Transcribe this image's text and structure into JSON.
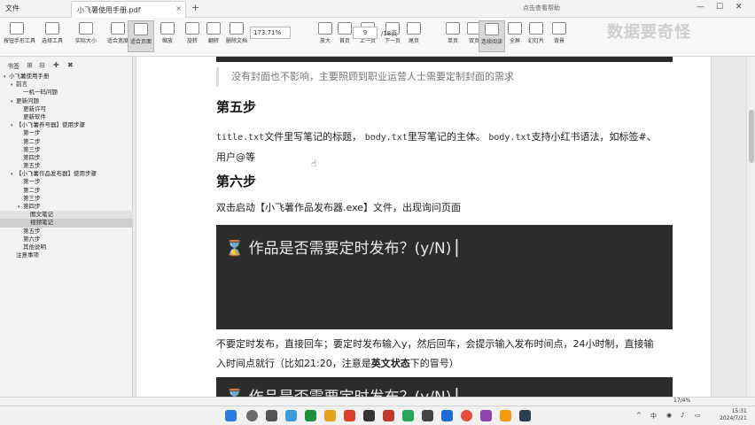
{
  "titlebar": {
    "file_menu": "文件",
    "tab_title": "小飞薯使用手册.pdf",
    "search_placeholder": "点击查看帮助"
  },
  "toolbar": {
    "items": [
      {
        "label": "按钮手形工具",
        "icon": "hand-icon"
      },
      {
        "label": "选择工具",
        "icon": "select-icon"
      },
      {
        "label": "实际大小",
        "icon": "actual-size-icon"
      },
      {
        "label": "适合宽度",
        "icon": "fit-width-icon"
      },
      {
        "label": "适合页面",
        "icon": "fit-page-icon"
      },
      {
        "label": "缩放",
        "icon": "zoom-icon"
      },
      {
        "label": "旋转",
        "icon": "rotate-icon"
      },
      {
        "label": "翻转",
        "icon": "flip-icon"
      },
      {
        "label": "删除文档",
        "icon": "delete-icon"
      },
      {
        "label": "缩小",
        "icon": "zoom-out-icon"
      },
      {
        "label": "放大",
        "icon": "zoom-in-icon"
      },
      {
        "label": "首页",
        "icon": "first-page-icon"
      },
      {
        "label": "上一页",
        "icon": "prev-page-icon"
      },
      {
        "label": "下一页",
        "icon": "next-page-icon"
      },
      {
        "label": "尾页",
        "icon": "last-page-icon"
      },
      {
        "label": "单页",
        "icon": "single-page-icon"
      },
      {
        "label": "双页",
        "icon": "double-page-icon"
      },
      {
        "label": "连续阅读",
        "icon": "continuous-icon"
      },
      {
        "label": "全屏",
        "icon": "fullscreen-icon"
      },
      {
        "label": "幻灯片",
        "icon": "slideshow-icon"
      },
      {
        "label": "背景",
        "icon": "background-icon"
      }
    ],
    "zoom_value": "173.71%",
    "page_current": "9",
    "page_total": "/18页"
  },
  "watermark": "数据要奇怪",
  "panel": {
    "tab_label": "书签",
    "tree": [
      {
        "label": "小飞薯使用手册",
        "level": 0,
        "arrow": "▾"
      },
      {
        "label": "前言",
        "level": 1,
        "arrow": "▾"
      },
      {
        "label": "一机一码问题",
        "level": 2,
        "arrow": ""
      },
      {
        "label": "更新问题",
        "level": 1,
        "arrow": "▾"
      },
      {
        "label": "更新许可",
        "level": 2,
        "arrow": ""
      },
      {
        "label": "更新软件",
        "level": 2,
        "arrow": ""
      },
      {
        "label": "【小飞薯养号器】使用步骤",
        "level": 1,
        "arrow": "▾"
      },
      {
        "label": "第一步",
        "level": 2,
        "arrow": ""
      },
      {
        "label": "第二步",
        "level": 2,
        "arrow": ""
      },
      {
        "label": "第三步",
        "level": 2,
        "arrow": ""
      },
      {
        "label": "第四步",
        "level": 2,
        "arrow": ""
      },
      {
        "label": "第五步",
        "level": 2,
        "arrow": ""
      },
      {
        "label": "【小飞薯作品发布器】使用步骤",
        "level": 1,
        "arrow": "▾"
      },
      {
        "label": "第一步",
        "level": 2,
        "arrow": ""
      },
      {
        "label": "第二步",
        "level": 2,
        "arrow": ""
      },
      {
        "label": "第三步",
        "level": 2,
        "arrow": ""
      },
      {
        "label": "第四步",
        "level": 2,
        "arrow": "▾"
      },
      {
        "label": "图文笔记",
        "level": 3,
        "arrow": ""
      },
      {
        "label": "视频笔记",
        "level": 3,
        "arrow": ""
      },
      {
        "label": "第五步",
        "level": 2,
        "arrow": ""
      },
      {
        "label": "第六步",
        "level": 2,
        "arrow": ""
      },
      {
        "label": "其他说明",
        "level": 2,
        "arrow": ""
      },
      {
        "label": "注意事项",
        "level": 1,
        "arrow": ""
      }
    ]
  },
  "document": {
    "quote": "没有封面也不影响，主要照顾到职业运营人士需要定制封面的需求",
    "h_step5": "第五步",
    "p5_code1": "title.txt",
    "p5_text1": "文件里写笔记的标题，",
    "p5_code2": "body.txt",
    "p5_text2": "里写笔记的主体。",
    "p5_code3": "body.txt",
    "p5_text3": "支持小红书语法，如标签#、",
    "p5_text4": "用户@等",
    "h_step6": "第六步",
    "p6_text": "双击启动【小飞薯作品发布器.exe】文件，出现询问页面",
    "terminal_prompt": "⌛ 作品是否需要定时发布？(y/N) ▏",
    "p7_line1": "不要定时发布，直接回车；要定时发布输入y，然后回车，会提示输入发布时间点，24小时制，直接输",
    "p7_line2a": "入时间点就行（比如21:20，注意是",
    "p7_bold": "英文状态",
    "p7_line2b": "下的冒号）",
    "terminal_prompt2": "⌛ 作品是否需要定时发布？(y/N) ▏"
  },
  "statusbar": {
    "page_indicator": "17/4%"
  },
  "taskbar": {
    "lang": "中",
    "time": "15:31",
    "date": "2024/7/21"
  }
}
